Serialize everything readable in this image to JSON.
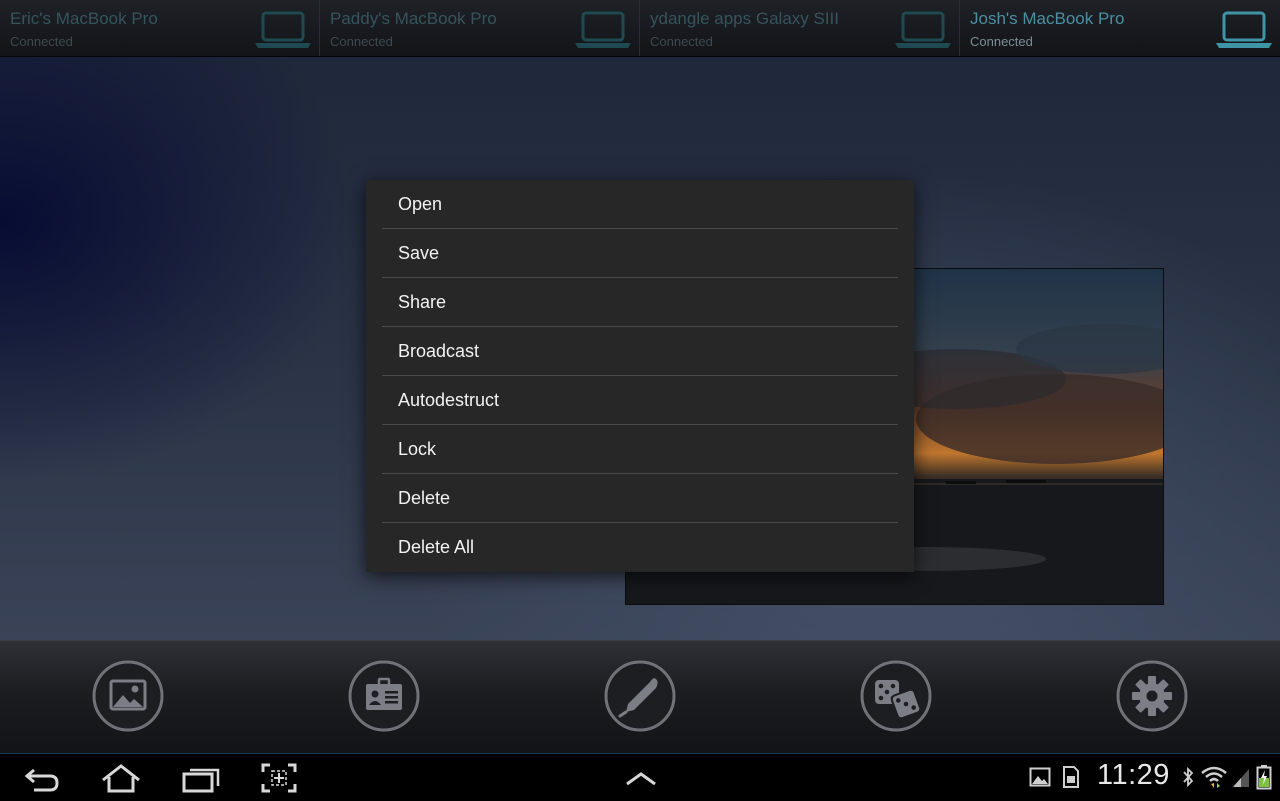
{
  "devices": [
    {
      "name": "Eric's MacBook Pro",
      "status": "Connected",
      "active": false,
      "icon": "laptop-icon"
    },
    {
      "name": "Paddy's MacBook Pro",
      "status": "Connected",
      "active": false,
      "icon": "laptop-icon"
    },
    {
      "name": "ydangle apps Galaxy SIII",
      "status": "Connected",
      "active": false,
      "icon": "laptop-icon"
    },
    {
      "name": "Josh's MacBook Pro",
      "status": "Connected",
      "active": true,
      "icon": "laptop-icon"
    }
  ],
  "context_menu": {
    "items": [
      "Open",
      "Save",
      "Share",
      "Broadcast",
      "Autodestruct",
      "Lock",
      "Delete",
      "Delete All"
    ]
  },
  "toolbar": {
    "buttons": [
      "image-icon",
      "contact-card-icon",
      "pen-icon",
      "dice-icon",
      "gear-icon"
    ]
  },
  "status_bar": {
    "time": "11:29",
    "icons": [
      "gallery-notification-icon",
      "sd-card-icon",
      "bluetooth-icon",
      "wifi-icon",
      "signal-icon",
      "battery-charging-icon"
    ]
  },
  "colors": {
    "accent": "#4a8fa0",
    "menu_bg": "#272727",
    "menu_divider": "#4a4a4a"
  }
}
